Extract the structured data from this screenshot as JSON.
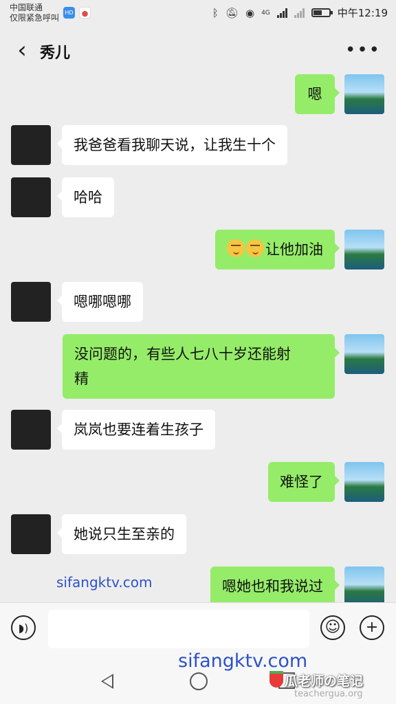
{
  "status_bar": {
    "carrier_line1": "中国联通",
    "carrier_line2": "仅限紧急呼叫",
    "badge_hd": "HD",
    "network": "4G",
    "time": "中午12:19",
    "battery_level": 0.55
  },
  "header": {
    "back_icon": "‹",
    "title": "秀儿",
    "more_icon": "•••"
  },
  "messages": [
    {
      "side": "out",
      "text": "嗯"
    },
    {
      "side": "in",
      "text": "我爸爸看我聊天说，让我生十个"
    },
    {
      "side": "in",
      "text": "哈哈"
    },
    {
      "side": "out",
      "emoji": "joy-emoji",
      "text": "让他加油"
    },
    {
      "side": "in",
      "text": "嗯哪嗯哪"
    },
    {
      "side": "out",
      "text_line1": "没问题的，有些人七八十岁还能射",
      "text_line2": "精"
    },
    {
      "side": "in",
      "text": "岚岚也要连着生孩子"
    },
    {
      "side": "out",
      "text": "难怪了"
    },
    {
      "side": "in",
      "text": "她说只生至亲的"
    },
    {
      "side": "out",
      "text": "嗯她也和我说过"
    }
  ],
  "watermarks": {
    "mid": "sifangktv.com",
    "big": "sifangktv.com",
    "brand": "瓜老师の笔记",
    "brand_url": "teachergua.org"
  },
  "input_bar": {
    "voice_icon": "voice-icon",
    "emoji_icon": "smiley-icon",
    "plus_icon": "+"
  },
  "colors": {
    "background": "#ededed",
    "outgoing_bubble": "#95ec69",
    "incoming_bubble": "#ffffff",
    "watermark": "#2d52c8"
  }
}
